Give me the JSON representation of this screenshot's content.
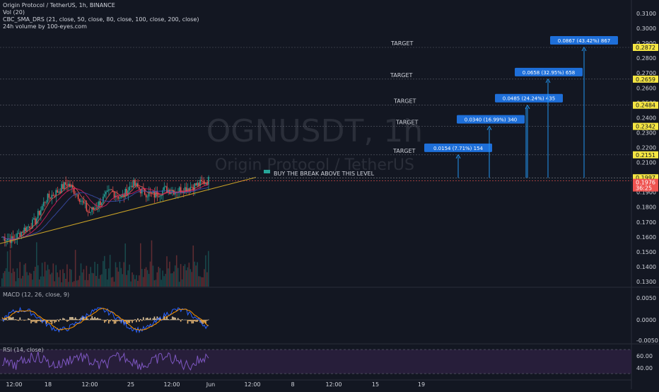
{
  "header": {
    "title": "Origin Protocol / TetherUS, 1h, BINANCE",
    "indicator_1": "Vol (20)",
    "indicator_2": "CBC_SMA_DRS (21, close, 50, close, 80, close, 100, close, 200, close)",
    "indicator_3": "24h volume by 100-eyes.com"
  },
  "watermark": {
    "symbol": "OGNUSDT, 1h",
    "name": "Origin Protocol / TetherUS"
  },
  "annotation": {
    "text": "BUY THE BREAK ABOVE THIS LEVEL",
    "flag_icon": "flag-icon"
  },
  "targets": [
    {
      "label": "TARGET",
      "level": "0.2151",
      "box": "0.0154 (7.71%) 154"
    },
    {
      "label": "TARGET",
      "level": "0.2342",
      "box": "0.0340 (16.99%) 340"
    },
    {
      "label": "TARGET",
      "level": "0.2484",
      "box": "0.0485 (24.24%) 435"
    },
    {
      "label": "TARGET",
      "level": "0.2659",
      "box": "0.0658 (32.95%) 658"
    },
    {
      "label": "TARGET",
      "level": "0.2872",
      "box": "0.0867 (43.42%) 867"
    }
  ],
  "price_axis": {
    "ticks": [
      "0.3100",
      "0.3000",
      "0.2900",
      "0.2800",
      "0.2700",
      "0.2600",
      "0.2500",
      "0.2400",
      "0.2300",
      "0.2200",
      "0.2100",
      "0.2000",
      "0.1900",
      "0.1800",
      "0.1700",
      "0.1600",
      "0.1500",
      "0.1400",
      "0.1300"
    ],
    "labels": {
      "buy_level": "0.1997",
      "last_price": "0.1976",
      "countdown": "36:25"
    }
  },
  "macd": {
    "label": "MACD (12, 26, close, 9)",
    "ticks": [
      "0.0050",
      "0.0000",
      "-0.0050"
    ]
  },
  "rsi": {
    "label": "RSI (14, close)",
    "ticks": [
      "60.00",
      "40.00"
    ]
  },
  "time_axis": {
    "ticks": [
      "12:00",
      "18",
      "12:00",
      "25",
      "12:00",
      "Jun",
      "12:00",
      "8",
      "12:00",
      "15",
      "19"
    ]
  },
  "colors": {
    "background": "#131722",
    "grid": "#1e222d",
    "text": "#d1d4dc",
    "up": "#26a69a",
    "down": "#ef5350",
    "trendline": "#c9a227",
    "target_box": "#1e6fd9",
    "target_level_label": "#f5e642",
    "arrow": "#2196f3",
    "macd": "#2962ff",
    "signal": "#ff9800",
    "rsi": "#7e57c2",
    "rsi_band": "#2a1f3d"
  },
  "chart_data": {
    "type": "line",
    "title": "Origin Protocol / TetherUS, 1h, BINANCE",
    "y_range": [
      0.125,
      0.315
    ],
    "x": [
      "~May 16 12:00",
      "May 18",
      "May 18 12:00",
      "May 25",
      "May 25 12:00",
      "Jun"
    ],
    "series": [
      {
        "name": "",
        "values": [
          0.16,
          0.158,
          0.165,
          0.17,
          0.185,
          0.19,
          0.196,
          0.188,
          0.176,
          0.183,
          0.191,
          0.186,
          0.196,
          0.19,
          0.188,
          0.192,
          0.191,
          0.193,
          0.195,
          0.198
        ]
      }
    ],
    "annotations": [
      {
        "text": "BUY THE BREAK ABOVE THIS LEVEL",
        "y": 0.1997
      },
      {
        "text": "TARGET",
        "y": 0.2151,
        "delta": "0.0154 (7.71%) 154"
      },
      {
        "text": "TARGET",
        "y": 0.2342,
        "delta": "0.0340 (16.99%) 340"
      },
      {
        "text": "TARGET",
        "y": 0.2484,
        "delta": "0.0485 (24.24%) 435"
      },
      {
        "text": "TARGET",
        "y": 0.2659,
        "delta": "0.0658 (32.95%) 658"
      },
      {
        "text": "TARGET",
        "y": 0.2872,
        "delta": "0.0867 (43.42%) 867"
      }
    ],
    "last_price": 0.1976,
    "grid": false
  }
}
